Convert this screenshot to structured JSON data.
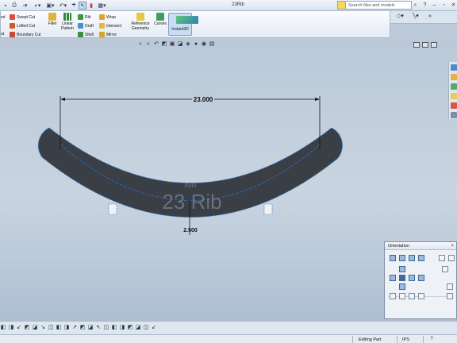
{
  "window": {
    "title": "23Rib"
  },
  "quick_access": [
    "new",
    "open",
    "save",
    "print",
    "undo",
    "rebuild",
    "select",
    "options"
  ],
  "search": {
    "placeholder": "Search files and models"
  },
  "ribbon": {
    "cut_group": {
      "swept_cut": "Swept Cut",
      "lofted_cut": "Lofted Cut",
      "boundary_cut": "Boundary Cut",
      "partial_top": "ed",
      "partial_bottom": "ut"
    },
    "fillet": "Fillet",
    "linear_pattern": "Linear Pattern",
    "rib": "Rib",
    "draft": "Draft",
    "shell": "Shell",
    "wrap": "Wrap",
    "intersect": "Intersect",
    "mirror": "Mirror",
    "reference_geometry": "Reference Geometry",
    "curves": "Curves",
    "instant3d": "Instant3D"
  },
  "model": {
    "top_dimension": "23.000",
    "bottom_dimension": "2.500",
    "watermark": "23 Rib",
    "watermark_small": "Axis"
  },
  "orientation_panel": {
    "title": "Orientation"
  },
  "status": {
    "mode": "Editing Part",
    "units": "IPS"
  },
  "colors": {
    "part_fill": "#3a3e45",
    "part_edge": "#2b6fd0",
    "rib_fill": "#f2f2f2",
    "dimension": "#101010",
    "ribbon_bg": "#eef3f8",
    "viewport": "#c0cbd8"
  }
}
